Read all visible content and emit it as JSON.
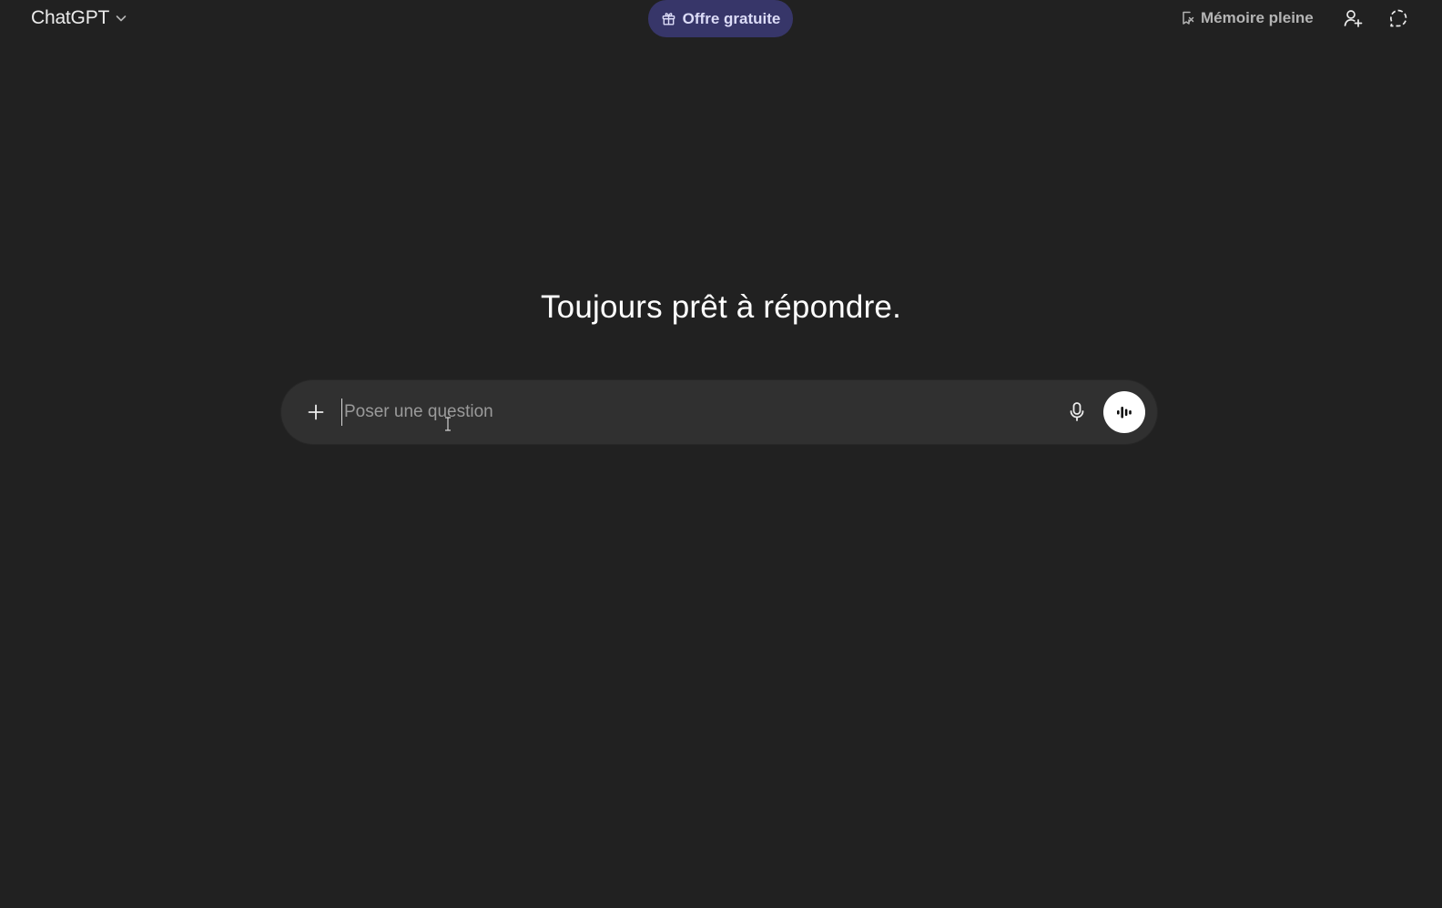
{
  "header": {
    "model_label": "ChatGPT",
    "offer_label": "Offre gratuite",
    "memory_label": "Mémoire pleine"
  },
  "main": {
    "headline": "Toujours prêt à répondre.",
    "composer": {
      "placeholder": "Poser une question",
      "value": ""
    }
  },
  "icons": {
    "model_chevron": "chevron-down-icon",
    "offer": "gift-icon",
    "memory": "memory-full-icon",
    "add_user": "add-user-icon",
    "temp_chat": "temporary-chat-icon",
    "plus": "plus-icon",
    "mic": "microphone-icon",
    "voice": "voice-mode-icon"
  },
  "colors": {
    "background": "#212121",
    "composer": "#303030",
    "offer_bg": "#373669",
    "offer_text": "#dcdcf7"
  }
}
